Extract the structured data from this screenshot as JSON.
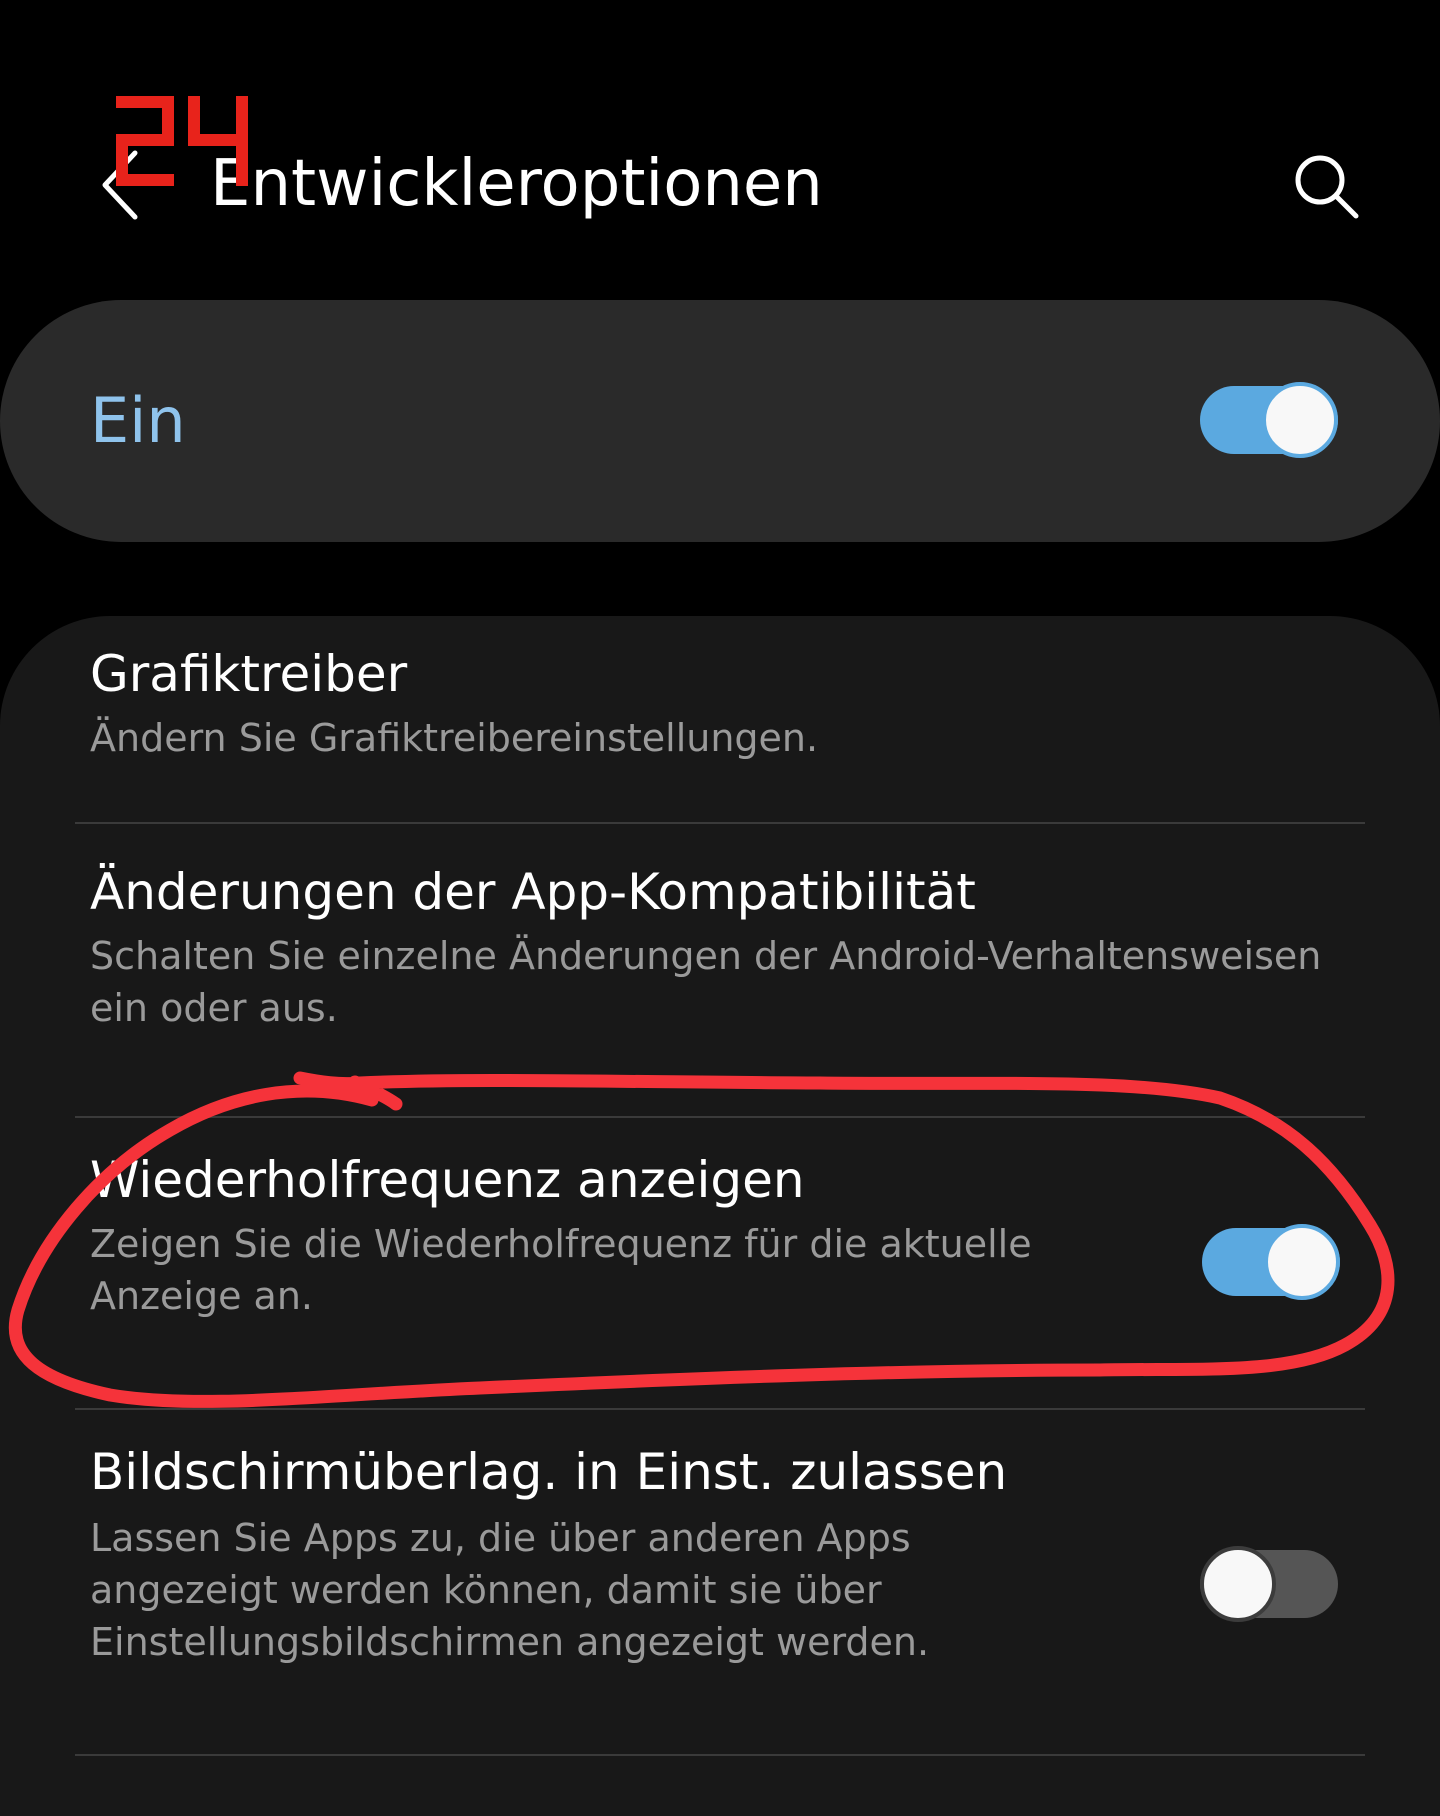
{
  "header": {
    "title": "Entwickleroptionen",
    "back_icon": "chevron-left-icon",
    "search_icon": "search-icon",
    "watermark_text": "24",
    "watermark_color": "#e8231b"
  },
  "master_switch": {
    "label": "Ein",
    "state": "on",
    "accent_color": "#5ba9e0",
    "label_color": "#8fc3ec"
  },
  "settings": [
    {
      "title": "Grafiktreiber",
      "summary": "Ändern Sie Grafiktreibereinstellungen."
    },
    {
      "title": "Änderungen der App-Kompatibilität",
      "summary": "Schalten Sie einzelne Änderungen der Android-Verhaltensweisen ein oder aus."
    },
    {
      "title": "Wiederholfrequenz anzeigen",
      "summary": "Zeigen Sie die Wiederholfrequenz für die aktuelle Anzeige an.",
      "toggle": "on",
      "highlighted": true
    },
    {
      "title": "Bildschirmüberlag. in Einst. zulassen",
      "summary": "Lassen Sie Apps zu, die über anderen Apps angezeigt werden können, damit sie über Einstellungsbildschirmen angezeigt werden.",
      "toggle": "off"
    }
  ],
  "highlight_color": "#f5333a"
}
